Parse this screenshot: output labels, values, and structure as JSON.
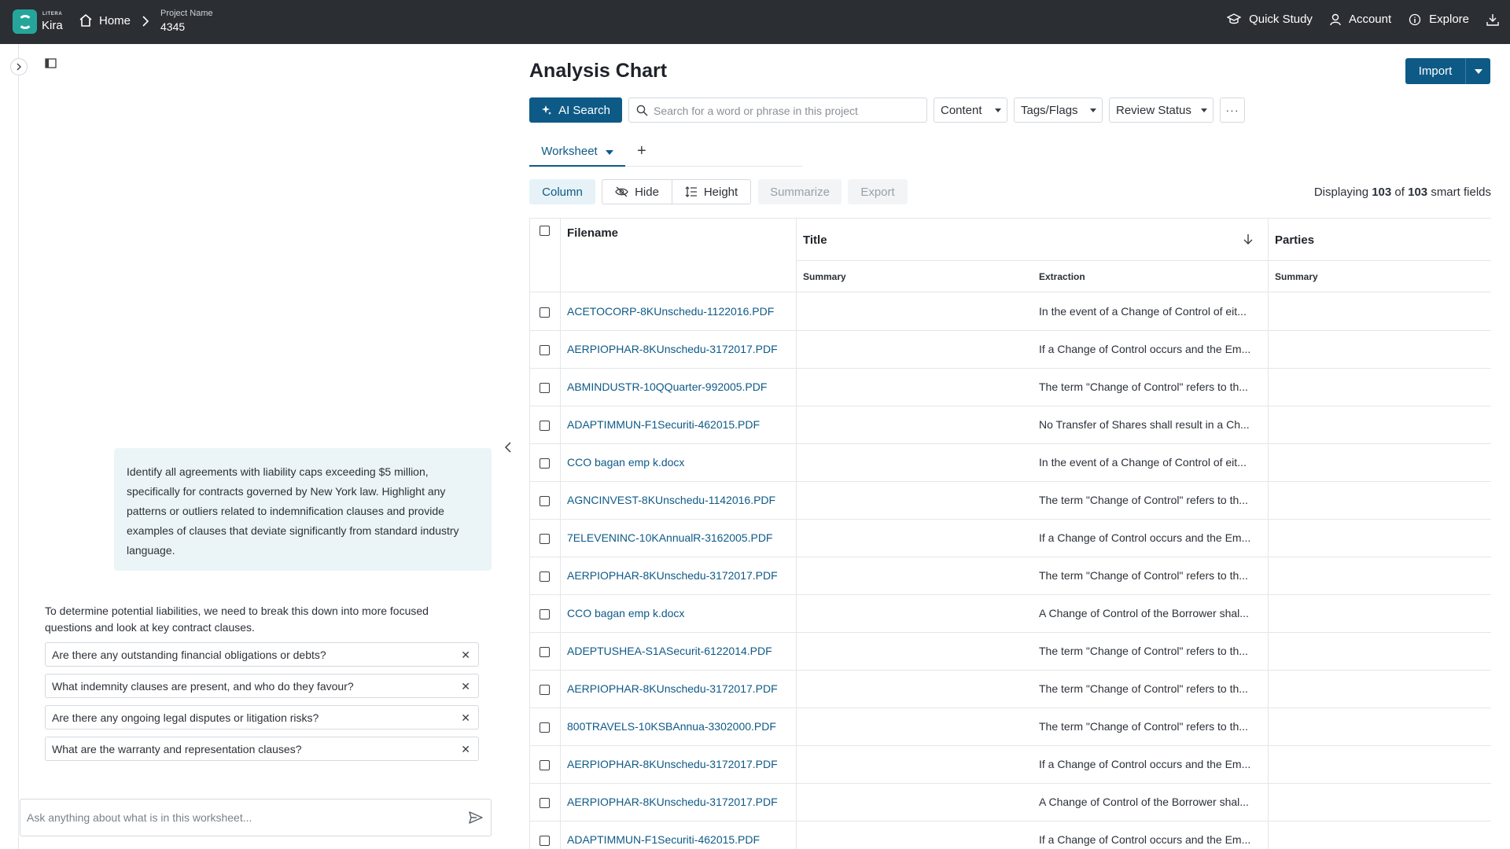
{
  "topbar": {
    "brand_small": "LITERA",
    "brand": "Kira",
    "home_label": "Home",
    "project_label": "Project Name",
    "project_value": "4345",
    "quick_study": "Quick Study",
    "account": "Account",
    "explore": "Explore"
  },
  "chat": {
    "user_message": "Identify all agreements with liability caps exceeding $5 million, specifically for contracts governed by New York law. Highlight any patterns or outliers related to indemnification clauses and provide examples of clauses that deviate significantly from standard industry language.",
    "assistant_message": "To determine potential liabilities, we need to break this down into more focused questions and look at key contract clauses.",
    "questions": [
      "Are there any outstanding financial obligations or debts?",
      "What indemnity clauses are present, and who do they favour?",
      "Are there any ongoing legal disputes or litigation risks?",
      "What are the warranty and representation clauses?"
    ],
    "remove_glyph": "✕",
    "input_placeholder": "Ask anything about what is in this worksheet..."
  },
  "main": {
    "title": "Analysis Chart",
    "import_label": "Import",
    "ai_search_label": "AI Search",
    "search_placeholder": "Search for a word or phrase in this project",
    "filters": [
      "Content",
      "Tags/Flags",
      "Review Status"
    ],
    "more_label": "···",
    "tab_label": "Worksheet",
    "tab_add": "+",
    "toolbar": {
      "column": "Column",
      "hide": "Hide",
      "height": "Height",
      "summarize": "Summarize",
      "export": "Export"
    },
    "displaying": {
      "prefix": "Displaying",
      "shown": "103",
      "of": "of",
      "total": "103",
      "suffix": "smart fields"
    }
  },
  "table": {
    "headers": {
      "filename": "Filename",
      "title": "Title",
      "parties": "Parties",
      "summary": "Summary",
      "extraction": "Extraction",
      "parties_summary": "Summary"
    },
    "rows": [
      {
        "filename": "ACETOCORP-8KUnschedu-1122016.PDF",
        "extraction": "In the event of a Change of Control of eit..."
      },
      {
        "filename": "AERPIOPHAR-8KUnschedu-3172017.PDF",
        "extraction": "If a Change of Control occurs and the Em..."
      },
      {
        "filename": "ABMINDUSTR-10QQuarter-992005.PDF",
        "extraction": "The term \"Change of Control\" refers to th..."
      },
      {
        "filename": "ADAPTIMMUN-F1Securiti-462015.PDF",
        "extraction": "No Transfer of Shares shall result in a Ch..."
      },
      {
        "filename": "CCO bagan emp k.docx",
        "extraction": "In the event of a Change of Control of eit..."
      },
      {
        "filename": "AGNCINVEST-8KUnschedu-1142016.PDF",
        "extraction": "The term \"Change of Control\" refers to th..."
      },
      {
        "filename": "7ELEVENINC-10KAnnualR-3162005.PDF",
        "extraction": "If a Change of Control occurs and the Em..."
      },
      {
        "filename": "AERPIOPHAR-8KUnschedu-3172017.PDF",
        "extraction": "The term \"Change of Control\" refers to th..."
      },
      {
        "filename": "CCO bagan emp k.docx",
        "extraction": "A Change of Control of the Borrower shal..."
      },
      {
        "filename": "ADEPTUSHEA-S1ASecurit-6122014.PDF",
        "extraction": "The term \"Change of Control\" refers to th..."
      },
      {
        "filename": "AERPIOPHAR-8KUnschedu-3172017.PDF",
        "extraction": "The term \"Change of Control\" refers to th..."
      },
      {
        "filename": "800TRAVELS-10KSBAnnua-3302000.PDF",
        "extraction": "The term \"Change of Control\" refers to th..."
      },
      {
        "filename": "AERPIOPHAR-8KUnschedu-3172017.PDF",
        "extraction": "If a Change of Control occurs and the Em..."
      },
      {
        "filename": "AERPIOPHAR-8KUnschedu-3172017.PDF",
        "extraction": "A Change of Control of the Borrower shal..."
      },
      {
        "filename": "ADAPTIMMUN-F1Securiti-462015.PDF",
        "extraction": "If a Change of Control occurs and the Em..."
      }
    ]
  },
  "colors": {
    "topbar": "#2b2e33",
    "accent": "#0e5a87",
    "brand_green": "#26a69a",
    "bubble": "#ebf5f8"
  }
}
